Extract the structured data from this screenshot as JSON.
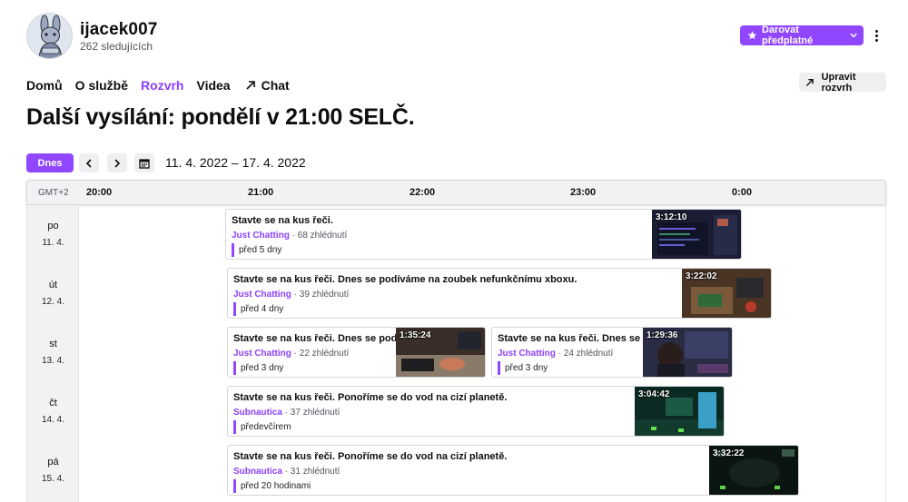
{
  "channel": {
    "name": "ijacek007",
    "followers": "262 sledujících",
    "avatar_icon": "bunny-avatar-icon"
  },
  "header": {
    "subscribe_label": "Darovat předplatné",
    "accent_color": "#9147ff"
  },
  "nav": {
    "items": [
      {
        "label": "Domů",
        "active": false
      },
      {
        "label": "O službě",
        "active": false
      },
      {
        "label": "Rozvrh",
        "active": true
      },
      {
        "label": "Videa",
        "active": false
      },
      {
        "label": "Chat",
        "active": false,
        "icon": "external-arrow-icon"
      }
    ]
  },
  "edit_schedule_label": "Upravit rozvrh",
  "headline": "Další vysílání: pondělí v 21:00 SELČ.",
  "controls": {
    "today_label": "Dnes",
    "date_range": "11. 4. 2022 – 17. 4. 2022"
  },
  "schedule": {
    "timezone": "GMT+2",
    "hours": [
      "20:00",
      "21:00",
      "22:00",
      "23:00",
      "0:00"
    ],
    "days": [
      {
        "name": "po",
        "date": "11. 4."
      },
      {
        "name": "út",
        "date": "12. 4."
      },
      {
        "name": "st",
        "date": "13. 4."
      },
      {
        "name": "čt",
        "date": "14. 4."
      },
      {
        "name": "pá",
        "date": "15. 4."
      }
    ],
    "streams": [
      {
        "title": "Stavte se na kus řeči.",
        "category": "Just Chatting",
        "views": "68 zhlédnutí",
        "ago": "před 5 dny",
        "duration": "3:12:10"
      },
      {
        "title": "Stavte se na kus řeči. Dnes se podíváme na zoubek nefunkčnímu xboxu.",
        "category": "Just Chatting",
        "views": "39 zhlédnutí",
        "ago": "před 4 dny",
        "duration": "3:22:02"
      },
      {
        "title": "Stavte se na kus řeči. Dnes se podívá",
        "category": "Just Chatting",
        "views": "22 zhlédnutí",
        "ago": "před 3 dny",
        "duration": "1:35:24"
      },
      {
        "title": "Stavte se na kus řeči. Dnes se podívá",
        "category": "Just Chatting",
        "views": "24 zhlédnutí",
        "ago": "před 3 dny",
        "duration": "1:29:36"
      },
      {
        "title": "Stavte se na kus řeči. Ponoříme se do vod na cizí planetě.",
        "category": "Subnautica",
        "views": "37 zhlédnutí",
        "ago": "předevčírem",
        "duration": "3:04:42"
      },
      {
        "title": "Stavte se na kus řeči. Ponoříme se do vod na cizí planetě.",
        "category": "Subnautica",
        "views": "31 zhlédnutí",
        "ago": "před 20 hodinami",
        "duration": "3:32:22"
      }
    ]
  }
}
